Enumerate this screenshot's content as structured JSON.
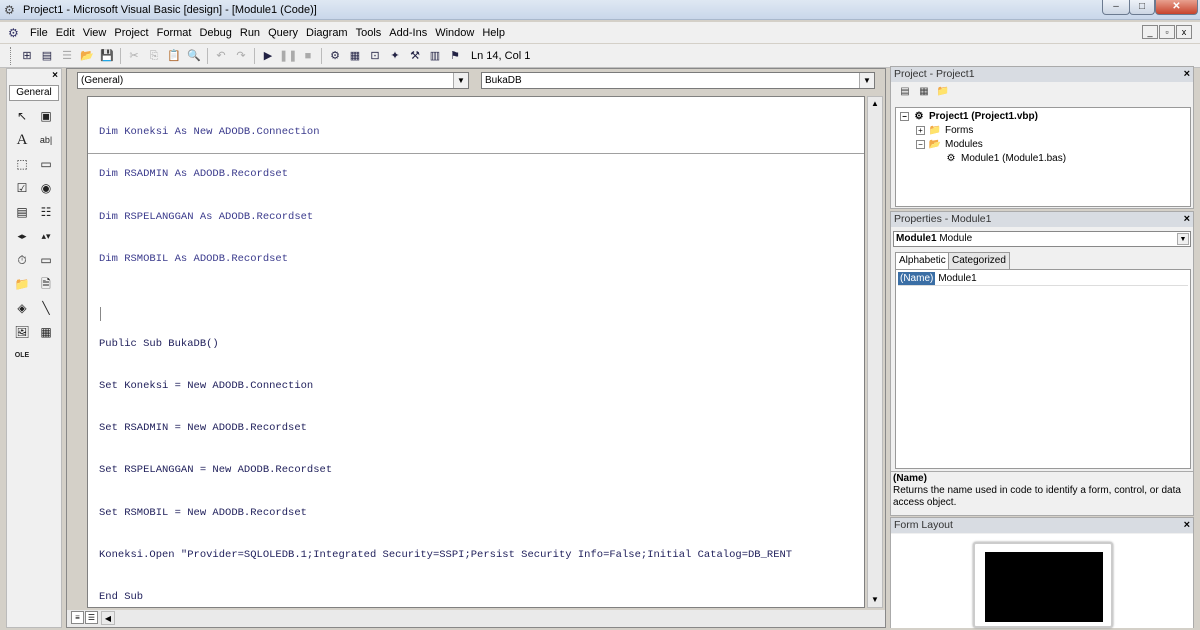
{
  "titlebar": {
    "title": "Project1 - Microsoft Visual Basic [design] - [Module1 (Code)]",
    "app_icon": "vb-app-icon",
    "min": "–",
    "max": "□",
    "close": "✕"
  },
  "menubar": {
    "items": [
      "File",
      "Edit",
      "View",
      "Project",
      "Format",
      "Debug",
      "Run",
      "Query",
      "Diagram",
      "Tools",
      "Add-Ins",
      "Window",
      "Help"
    ],
    "mdi_controls": [
      "_",
      "▫",
      "x"
    ]
  },
  "toolbar": {
    "position": "Ln 14, Col 1"
  },
  "toolbox": {
    "close": "×",
    "tab": "General"
  },
  "code_window": {
    "object_combo": "(General)",
    "procedure_combo": "BukaDB",
    "declarations": [
      "Dim Koneksi As New ADODB.Connection",
      "Dim RSADMIN As ADODB.Recordset",
      "Dim RSPELANGGAN As ADODB.Recordset",
      "Dim RSMOBIL As ADODB.Recordset"
    ],
    "procedure": [
      "Public Sub BukaDB()",
      "Set Koneksi = New ADODB.Connection",
      "Set RSADMIN = New ADODB.Recordset",
      "Set RSPELANGGAN = New ADODB.Recordset",
      "Set RSMOBIL = New ADODB.Recordset",
      "Koneksi.Open \"Provider=SQLOLEDB.1;Integrated Security=SSPI;Persist Security Info=False;Initial Catalog=DB_RENT",
      "End Sub"
    ]
  },
  "project_panel": {
    "title": "Project - Project1",
    "close": "×",
    "tree": {
      "root": "Project1 (Project1.vbp)",
      "forms": "Forms",
      "modules": "Modules",
      "module1": "Module1 (Module1.bas)"
    }
  },
  "properties_panel": {
    "title": "Properties - Module1",
    "close": "×",
    "object_name": "Module1",
    "object_type": "Module",
    "tabs": [
      "Alphabetic",
      "Categorized"
    ],
    "rows": [
      {
        "name": "(Name)",
        "value": "Module1"
      }
    ],
    "desc_title": "(Name)",
    "desc_text": "Returns the name used in code to identify a form, control, or data access object."
  },
  "form_layout_panel": {
    "title": "Form Layout",
    "close": "×"
  }
}
